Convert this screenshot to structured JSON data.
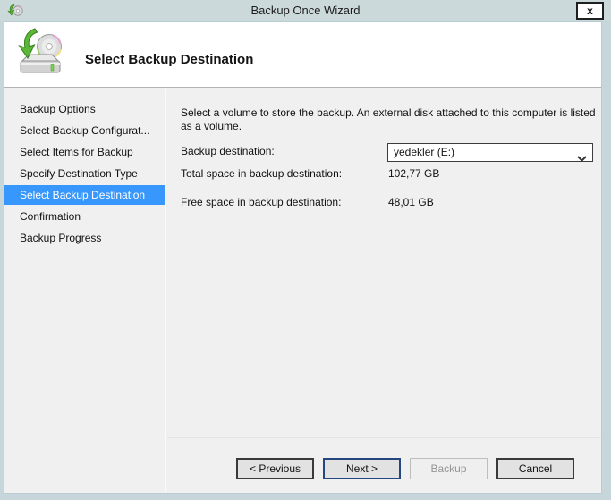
{
  "window": {
    "title": "Backup Once Wizard"
  },
  "titlebar": {
    "close_label": "x"
  },
  "header": {
    "title": "Select Backup Destination"
  },
  "sidebar": {
    "items": [
      {
        "label": "Backup Options",
        "selected": false
      },
      {
        "label": "Select Backup Configurat...",
        "selected": false
      },
      {
        "label": "Select Items for Backup",
        "selected": false
      },
      {
        "label": "Specify Destination Type",
        "selected": false
      },
      {
        "label": "Select Backup Destination",
        "selected": true
      },
      {
        "label": "Confirmation",
        "selected": false
      },
      {
        "label": "Backup Progress",
        "selected": false
      }
    ]
  },
  "content": {
    "description": "Select a volume to store the backup. An external disk attached to this computer is listed as a volume.",
    "destination_label": "Backup destination:",
    "destination_value": "yedekler (E:)",
    "total_label": "Total space in backup destination:",
    "total_value": "102,77 GB",
    "free_label": "Free space in backup destination:",
    "free_value": "48,01 GB"
  },
  "footer": {
    "previous_label": "< Previous",
    "next_label": "Next >",
    "backup_label": "Backup",
    "cancel_label": "Cancel"
  },
  "icons": {
    "titlebar_icon": "backup-wizard-icon",
    "header_icon": "backup-drive-with-disc-and-green-arrow",
    "combobox_icon": "chevron-down-icon",
    "close_icon": "close-x"
  },
  "colors": {
    "frame": "#c6d6da",
    "titlebar_bg": "#ccd9db",
    "panel_bg": "#f0f0f0",
    "header_bg": "#ffffff",
    "selection_blue": "#3897fd",
    "default_button_border": "#26477e"
  }
}
